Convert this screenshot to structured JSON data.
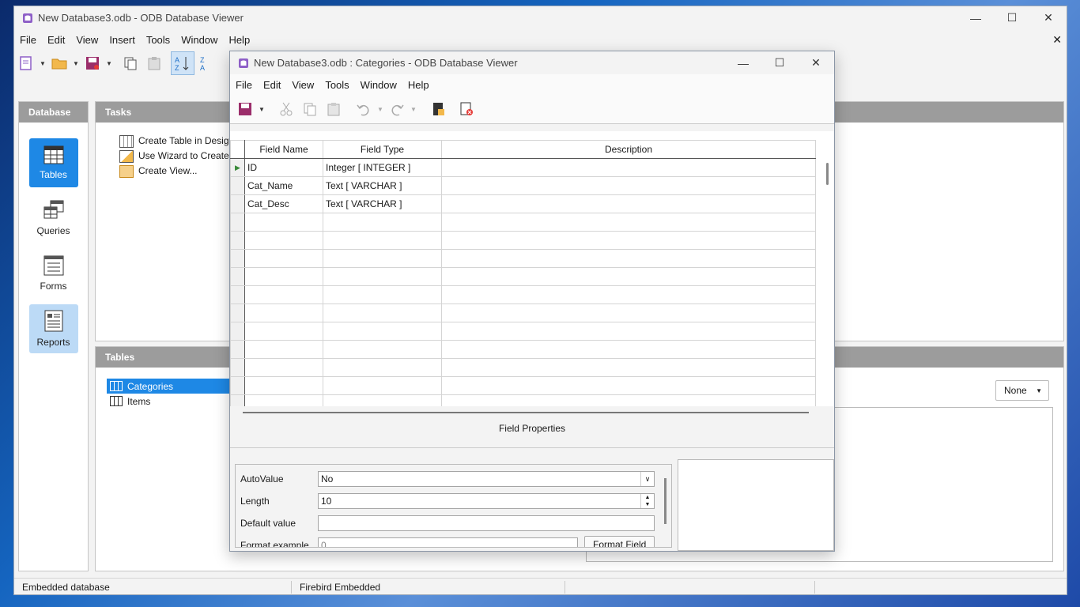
{
  "main_window": {
    "title": "New Database3.odb - ODB Database Viewer",
    "menu": [
      "File",
      "Edit",
      "View",
      "Insert",
      "Tools",
      "Window",
      "Help"
    ],
    "database_panel": {
      "header": "Database",
      "items": [
        {
          "label": "Tables",
          "icon": "tables-icon"
        },
        {
          "label": "Queries",
          "icon": "queries-icon"
        },
        {
          "label": "Forms",
          "icon": "forms-icon"
        },
        {
          "label": "Reports",
          "icon": "reports-icon"
        }
      ]
    },
    "tasks_panel": {
      "header": "Tasks",
      "items": [
        "Create Table in Design",
        "Use Wizard to Create T",
        "Create View..."
      ]
    },
    "tables_panel": {
      "header": "Tables",
      "items": [
        "Categories",
        "Items"
      ],
      "preview_select": "None"
    },
    "status": [
      "Embedded database",
      "Firebird Embedded",
      "",
      ""
    ]
  },
  "child_window": {
    "title": "New Database3.odb : Categories - ODB Database Viewer",
    "menu": [
      "File",
      "Edit",
      "View",
      "Tools",
      "Window",
      "Help"
    ],
    "grid": {
      "headers": [
        "Field Name",
        "Field Type",
        "Description"
      ],
      "rows": [
        {
          "name": "ID",
          "type": "Integer [ INTEGER ]",
          "desc": ""
        },
        {
          "name": "Cat_Name",
          "type": "Text [ VARCHAR ]",
          "desc": ""
        },
        {
          "name": "Cat_Desc",
          "type": "Text [ VARCHAR ]",
          "desc": ""
        }
      ]
    },
    "field_properties": {
      "header": "Field Properties",
      "auto_value_label": "AutoValue",
      "auto_value": "No",
      "length_label": "Length",
      "length": "10",
      "default_label": "Default value",
      "default_value": "",
      "format_label": "Format example",
      "format_value": "0",
      "format_button": "Format Field"
    }
  }
}
